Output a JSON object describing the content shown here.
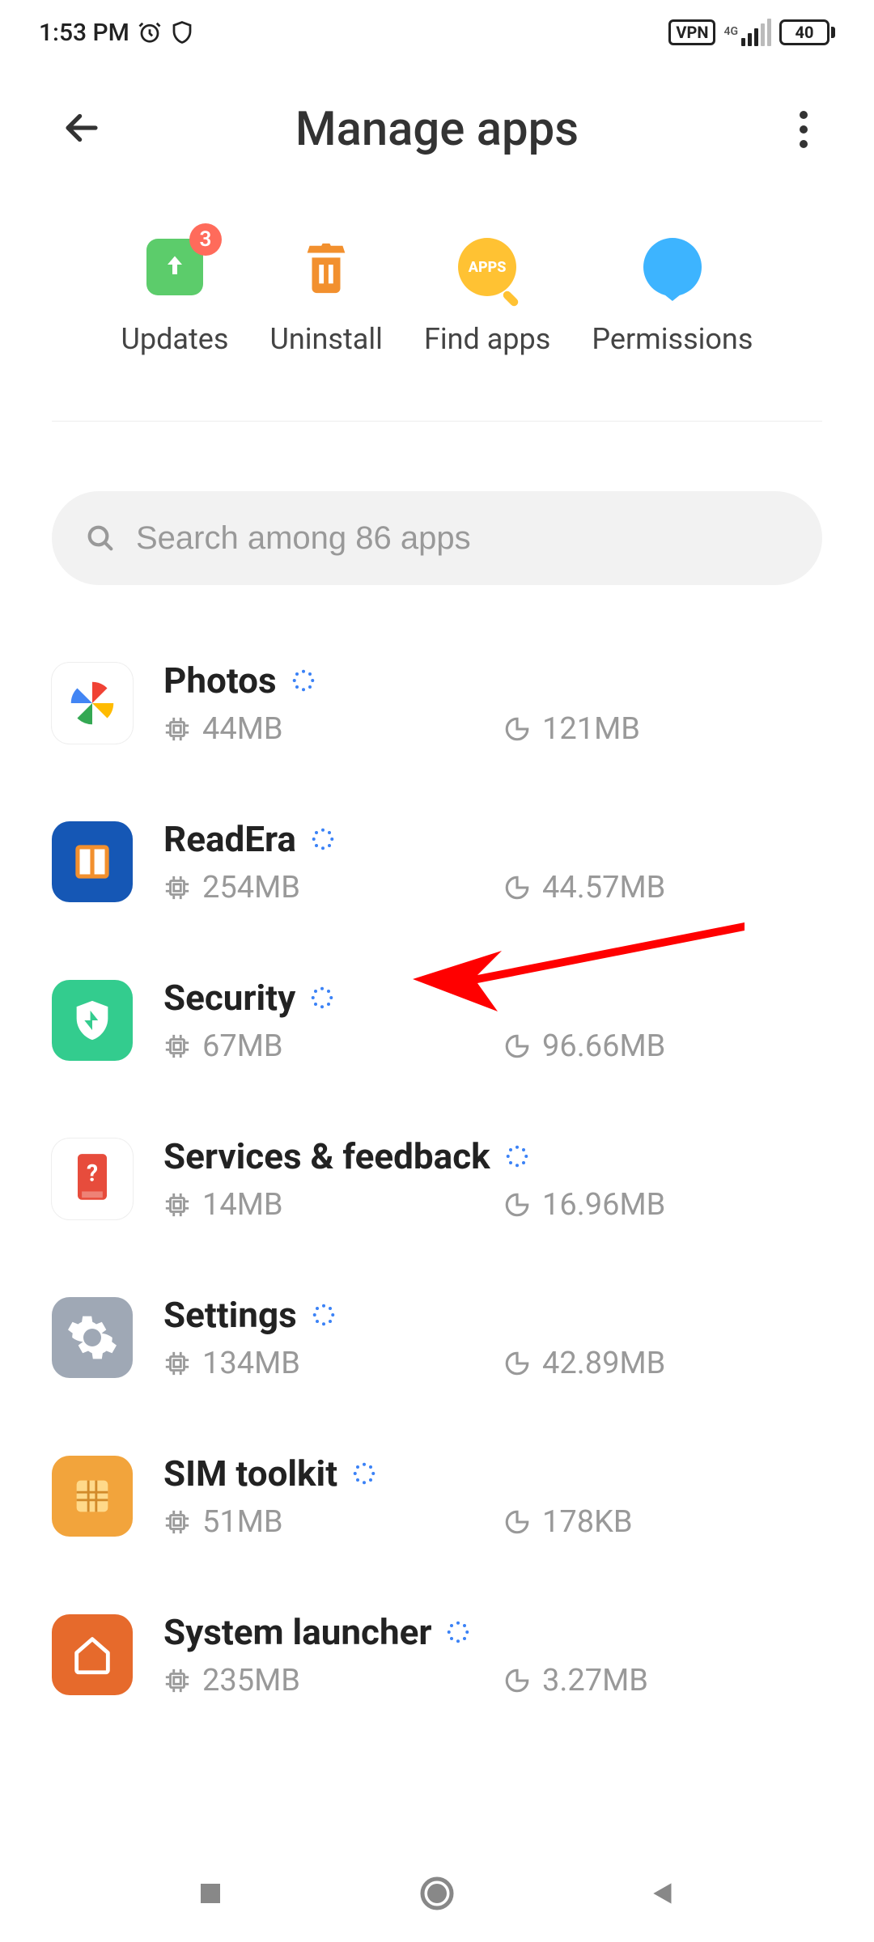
{
  "status": {
    "time": "1:53 PM",
    "vpn": "VPN",
    "net_label": "4G",
    "battery": "40"
  },
  "header": {
    "title": "Manage apps"
  },
  "actions": {
    "updates": {
      "label": "Updates",
      "badge": "3"
    },
    "uninstall": {
      "label": "Uninstall"
    },
    "find": {
      "label": "Find apps",
      "icon_text": "APPS"
    },
    "permissions": {
      "label": "Permissions"
    }
  },
  "search": {
    "placeholder": "Search among 86 apps"
  },
  "apps": [
    {
      "name": "Photos",
      "storage": "44MB",
      "data": "121MB"
    },
    {
      "name": "ReadEra",
      "storage": "254MB",
      "data": "44.57MB"
    },
    {
      "name": "Security",
      "storage": "67MB",
      "data": "96.66MB"
    },
    {
      "name": "Services & feedback",
      "storage": "14MB",
      "data": "16.96MB"
    },
    {
      "name": "Settings",
      "storage": "134MB",
      "data": "42.89MB"
    },
    {
      "name": "SIM toolkit",
      "storage": "51MB",
      "data": "178KB"
    },
    {
      "name": "System launcher",
      "storage": "235MB",
      "data": "3.27MB"
    }
  ]
}
